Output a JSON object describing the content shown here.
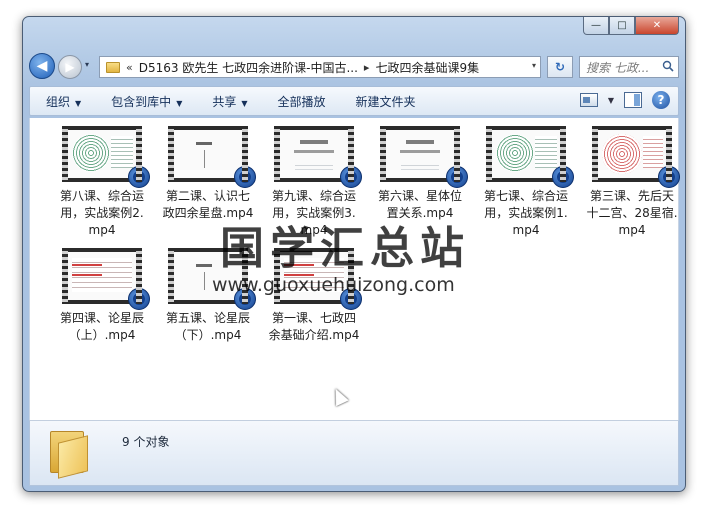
{
  "window": {
    "caption_minimize": "—",
    "caption_maximize": "□",
    "caption_close": "✕"
  },
  "address_bar": {
    "prefix": "«",
    "crumbs": [
      "D5163 欧先生 七政四余进阶课-中国古...",
      "七政四余基础课9集"
    ],
    "separator": "▸",
    "dropdown": "▾",
    "refresh_glyph": "↻"
  },
  "search": {
    "placeholder": "搜索 七政..."
  },
  "toolbar": {
    "organize": "组织",
    "include_in_library": "包含到库中",
    "share": "共享",
    "play_all": "全部播放",
    "new_folder": "新建文件夹",
    "help": "?"
  },
  "files": [
    {
      "name": "第八课、综合运用，实战案例2.mp4",
      "thumb": "circle"
    },
    {
      "name": "第二课、认识七政四余星盘.mp4",
      "thumb": "blank"
    },
    {
      "name": "第九课、综合运用，实战案例3.mp4",
      "thumb": "title"
    },
    {
      "name": "第六课、星体位置关系.mp4",
      "thumb": "title"
    },
    {
      "name": "第七课、综合运用，实战案例1.mp4",
      "thumb": "circle"
    },
    {
      "name": "第三课、先后天十二宫、28星宿.mp4",
      "thumb": "red"
    },
    {
      "name": "第四课、论星辰（上）.mp4",
      "thumb": "doc"
    },
    {
      "name": "第五课、论星辰（下）.mp4",
      "thumb": "blank"
    },
    {
      "name": "第一课、七政四余基础介绍.mp4",
      "thumb": "doc"
    }
  ],
  "watermark": {
    "title": "国学汇总站",
    "url": "www.guoxuehuizong.com"
  },
  "details": {
    "item_count": "9 个对象"
  },
  "colors": {
    "title_blue": "#15305a",
    "frame_blue": "#b4cbe6",
    "badge_blue": "#123f8c"
  }
}
